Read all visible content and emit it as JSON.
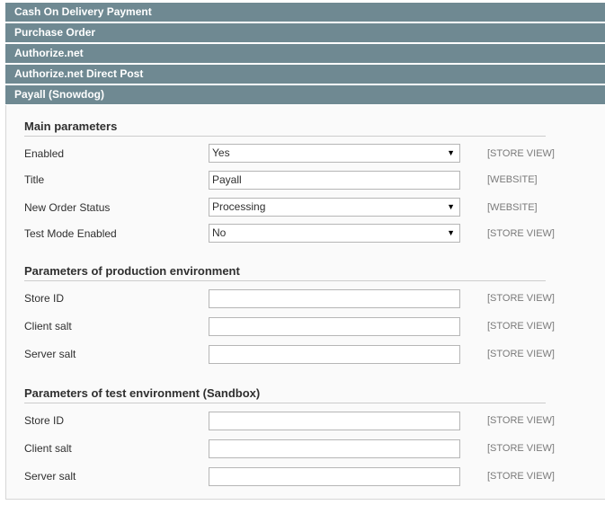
{
  "sections": {
    "cod": "Cash On Delivery Payment",
    "po": "Purchase Order",
    "authnet": "Authorize.net",
    "authnet_direct": "Authorize.net Direct Post",
    "payall": "Payall (Snowdog)"
  },
  "main": {
    "legend": "Main parameters",
    "enabled_label": "Enabled",
    "enabled_value": "Yes",
    "enabled_scope": "[STORE VIEW]",
    "title_label": "Title",
    "title_value": "Payall",
    "title_scope": "[WEBSITE]",
    "status_label": "New Order Status",
    "status_value": "Processing",
    "status_scope": "[WEBSITE]",
    "testmode_label": "Test Mode Enabled",
    "testmode_value": "No",
    "testmode_scope": "[STORE VIEW]"
  },
  "production": {
    "legend": "Parameters of production environment",
    "store_label": "Store ID",
    "store_value": "",
    "store_scope": "[STORE VIEW]",
    "client_label": "Client salt",
    "client_value": "",
    "client_scope": "[STORE VIEW]",
    "server_label": "Server salt",
    "server_value": "",
    "server_scope": "[STORE VIEW]"
  },
  "sandbox": {
    "legend": "Parameters of test environment (Sandbox)",
    "store_label": "Store ID",
    "store_value": "",
    "store_scope": "[STORE VIEW]",
    "client_label": "Client salt",
    "client_value": "",
    "client_scope": "[STORE VIEW]",
    "server_label": "Server salt",
    "server_value": "",
    "server_scope": "[STORE VIEW]"
  },
  "icons": {
    "dropdown": "chevron-down-icon"
  },
  "colors": {
    "header_bg": "#6f8992",
    "panel_bg": "#fafafa",
    "scope_text": "#7a7a7a"
  }
}
